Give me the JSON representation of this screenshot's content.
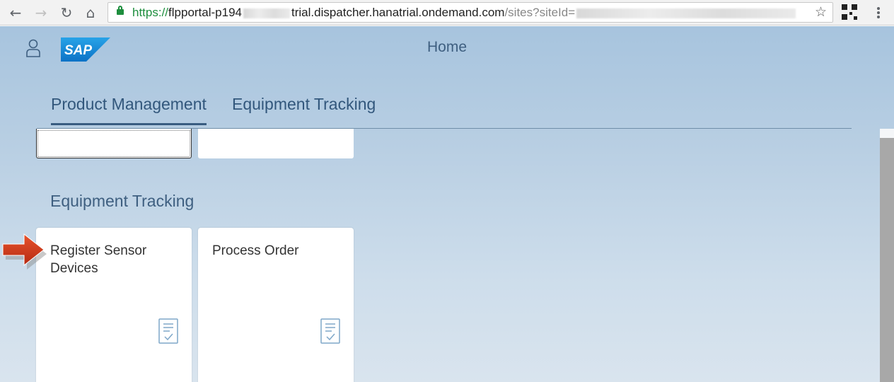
{
  "browser": {
    "url_scheme": "https://",
    "url_host_start": "flpportal-p194",
    "url_host_end": "trial.dispatcher.hanatrial.ondemand.com",
    "url_path": "/sites?siteId=",
    "back_icon": "←",
    "forward_icon": "→",
    "reload_icon": "↻",
    "home_icon": "⌂",
    "bookmark_icon": "☆"
  },
  "shell": {
    "title": "Home"
  },
  "tabs": [
    {
      "label": "Product Management",
      "active": true
    },
    {
      "label": "Equipment Tracking",
      "active": false
    }
  ],
  "group": {
    "title": "Equipment Tracking",
    "tiles": [
      {
        "label": "Register Sensor Devices",
        "icon": "task-checklist-icon"
      },
      {
        "label": "Process Order",
        "icon": "task-checklist-icon"
      }
    ]
  },
  "colors": {
    "sap_blue": "#1e8ee1",
    "tab_text": "#32577c",
    "callout_arrow": "#d23b1c"
  }
}
